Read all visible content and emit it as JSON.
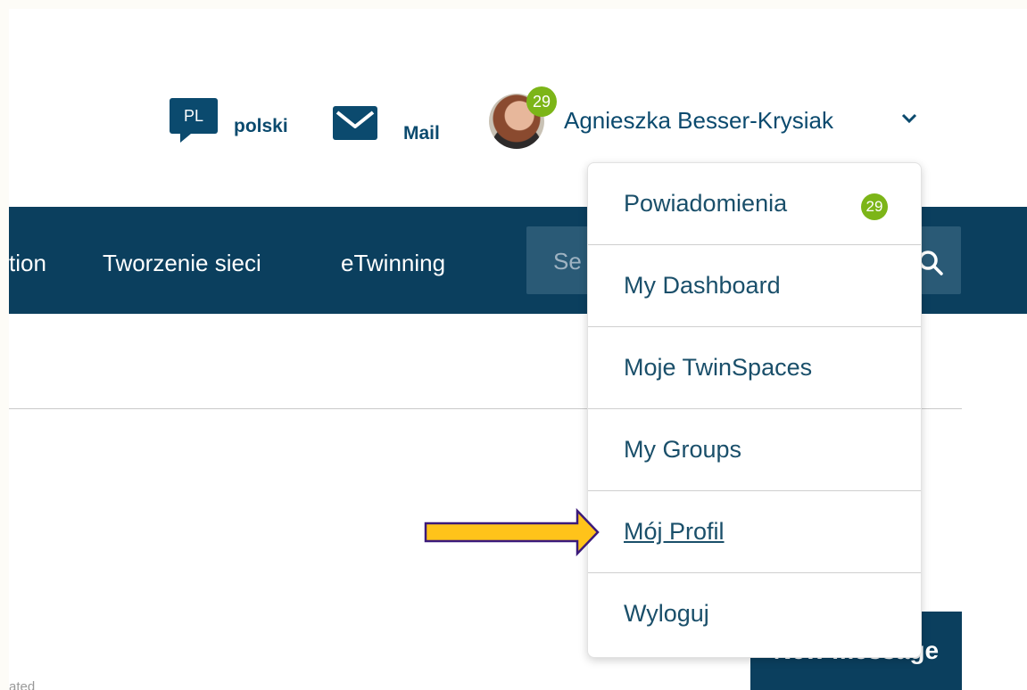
{
  "header": {
    "language_code": "PL",
    "language_label": "polski",
    "mail_label": "Mail",
    "user_name": "Agnieszka Besser-Krysiak",
    "notification_count": "29"
  },
  "nav": {
    "items": [
      "tion",
      "Tworzenie sieci",
      "eTwinning"
    ],
    "search_placeholder": "Se"
  },
  "dropdown": {
    "items": [
      {
        "label": "Powiadomienia",
        "badge": "29"
      },
      {
        "label": "My Dashboard"
      },
      {
        "label": "Moje TwinSpaces"
      },
      {
        "label": "My Groups"
      },
      {
        "label": "Mój Profil"
      },
      {
        "label": "Wyloguj"
      }
    ]
  },
  "buttons": {
    "new_message": "New message"
  },
  "misc": {
    "bottom_text": "ated"
  },
  "colors": {
    "brand": "#0b3f5e",
    "badge": "#7cb518",
    "arrow": "#ffc31a",
    "arrow_border": "#3b1a7a"
  }
}
